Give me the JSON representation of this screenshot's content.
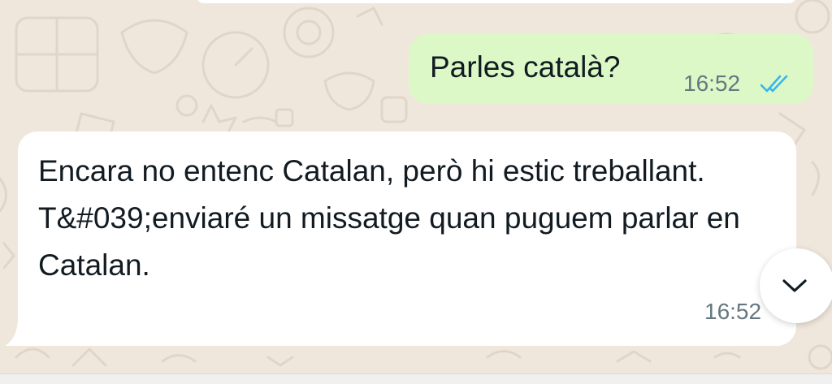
{
  "chat": {
    "messages": [
      {
        "direction": "outgoing",
        "text": "Parles català?",
        "time": "16:52",
        "status": "read",
        "status_icon": "double-check-icon"
      },
      {
        "direction": "incoming",
        "text": "Encara no entenc Catalan, però hi estic treballant. T&#039;enviaré un missatge quan puguem parlar en Catalan.",
        "time": "16:52"
      }
    ],
    "scroll_button_icon": "chevron-down-icon"
  },
  "colors": {
    "background": "#efe7dc",
    "outgoing_bubble": "#dcf8c6",
    "incoming_bubble": "#ffffff",
    "read_ticks": "#34b7f1",
    "timestamp": "#667781",
    "text": "#111b21"
  }
}
